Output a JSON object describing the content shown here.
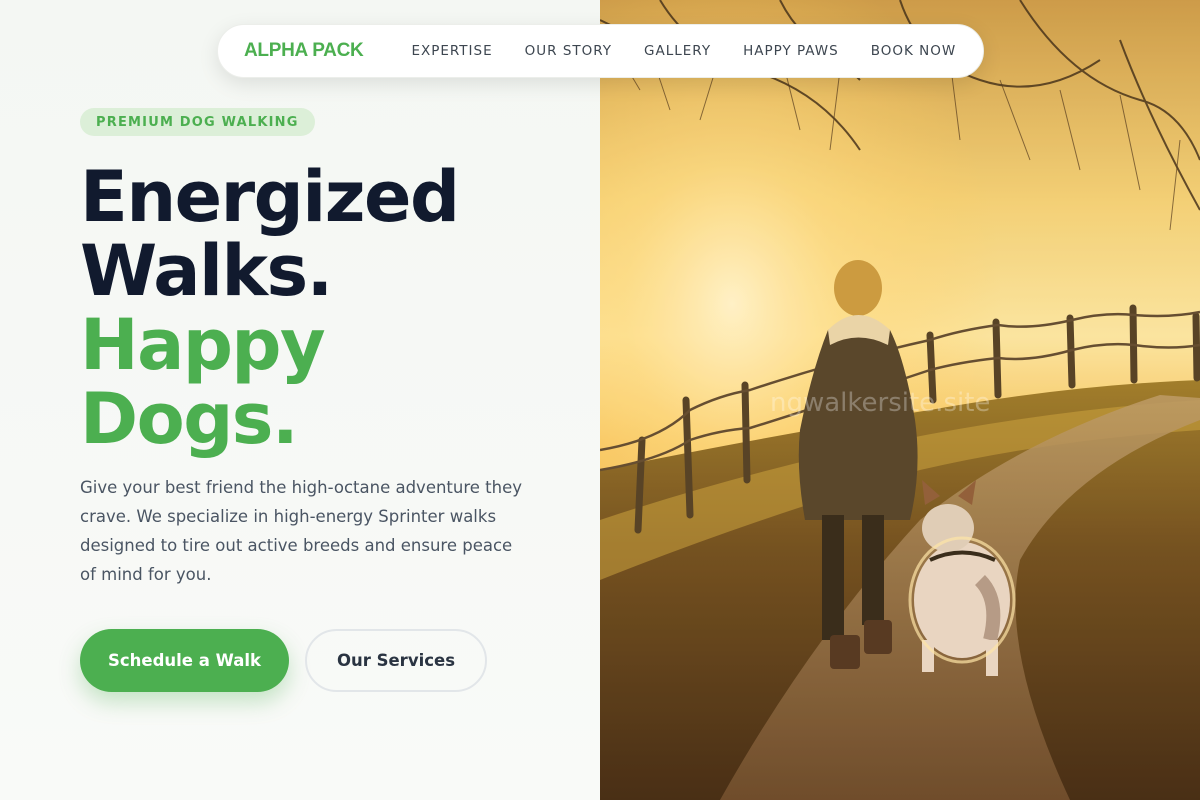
{
  "nav": {
    "brand": "ALPHA PACK",
    "items": [
      "EXPERTISE",
      "OUR STORY",
      "GALLERY",
      "HAPPY PAWS",
      "BOOK NOW"
    ]
  },
  "hero": {
    "badge": "PREMIUM DOG WALKING",
    "headline_line1": "Energized",
    "headline_line2": "Walks.",
    "headline_line3": "Happy",
    "headline_line4": "Dogs.",
    "description": "Give your best friend the high-octane adventure they crave. We specialize in high-energy Sprinter walks designed to tire out active breeds and ensure peace of mind for you.",
    "primary_button": "Schedule a Walk",
    "secondary_button": "Our Services"
  },
  "photo": {
    "watermark": "ngwalkersite.site"
  },
  "colors": {
    "accent": "#4caf50",
    "heading": "#111a2e",
    "body_text": "#4a5563",
    "badge_bg": "#dcefd8"
  }
}
